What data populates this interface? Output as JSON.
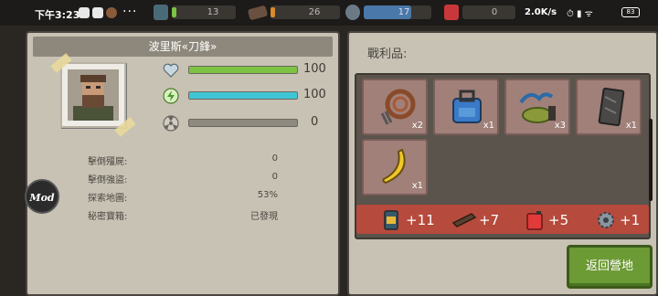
{
  "status_bar": {
    "time": "下午3:23",
    "dots": "···",
    "net_rate": "2.0K/s",
    "battery": "83",
    "icons": "⏱ ▮ ᯤ"
  },
  "resources": [
    {
      "name": "canned-food",
      "value": "13"
    },
    {
      "name": "wood-plank",
      "value": "26"
    },
    {
      "name": "gear",
      "value": "17"
    },
    {
      "name": "fuel-can",
      "value": "0"
    }
  ],
  "character": {
    "name": "波里斯«刀鋒»",
    "health": {
      "value": "100",
      "fraction": 1.0,
      "color": "#7cc243"
    },
    "energy": {
      "value": "100",
      "fraction": 1.0,
      "color": "#3fc5d4"
    },
    "radiation": {
      "value": "0",
      "fraction": 0.0,
      "color": "#b3ad9f"
    }
  },
  "info": [
    {
      "label": "擊倒殭屍:",
      "value": "0"
    },
    {
      "label": "擊倒強盜:",
      "value": "0"
    },
    {
      "label": "探索地圖:",
      "value": "53%"
    },
    {
      "label": "秘密寶箱:",
      "value": "已發現"
    }
  ],
  "mod_label": "Mod",
  "loot": {
    "title": "戰利品:",
    "items": [
      {
        "name": "rope-bundle",
        "qty": "x2"
      },
      {
        "name": "blue-backpack",
        "qty": "x1"
      },
      {
        "name": "cloth-scraps",
        "qty": "x3"
      },
      {
        "name": "tin-sheet",
        "qty": "x1"
      },
      {
        "name": "banana",
        "qty": "x1"
      }
    ],
    "summary": [
      {
        "name": "canned-food",
        "value": "+11"
      },
      {
        "name": "wood-plank",
        "value": "+7"
      },
      {
        "name": "fuel-can",
        "value": "+5"
      },
      {
        "name": "gear",
        "value": "+1"
      }
    ]
  },
  "return_button": "返回營地",
  "colors": {
    "panel": "#c8c2b4",
    "loot_slot": "#a08079",
    "summary_bar": "#b64a3c",
    "return_button": "#6c9a34"
  }
}
